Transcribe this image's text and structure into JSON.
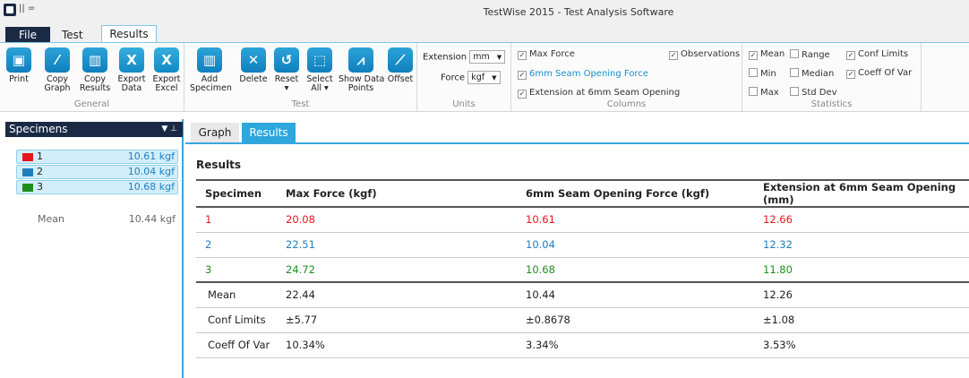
{
  "window": {
    "title": "TestWise 2015 - Test Analysis Software",
    "qat_glyph": "||  ="
  },
  "menu_tabs": {
    "file": "File",
    "test": "Test",
    "results": "Results"
  },
  "ribbon": {
    "general": {
      "label": "General",
      "buttons": [
        {
          "label": "Print",
          "icon": "printer-icon"
        },
        {
          "label": "Copy\nGraph",
          "icon": "copy-graph-icon"
        },
        {
          "label": "Copy\nResults",
          "icon": "copy-results-icon"
        },
        {
          "label": "Export\nData",
          "icon": "excel-icon"
        },
        {
          "label": "Export\nExcel",
          "icon": "excel-icon"
        }
      ]
    },
    "test": {
      "label": "Test",
      "buttons": [
        {
          "label": "Add\nSpecimen",
          "icon": "add-specimen-icon"
        },
        {
          "label": "Delete",
          "icon": "delete-icon"
        },
        {
          "label": "Reset\n▾",
          "icon": "reset-icon"
        },
        {
          "label": "Select\nAll ▾",
          "icon": "select-all-icon"
        },
        {
          "label": "Show Data\nPoints",
          "icon": "data-points-icon"
        },
        {
          "label": "Offset",
          "icon": "offset-icon"
        }
      ]
    },
    "units": {
      "label": "Units",
      "extension_label": "Extension",
      "extension_value": "mm",
      "force_label": "Force",
      "force_value": "kgf"
    },
    "columns": {
      "label": "Columns",
      "max_force": "Max Force",
      "seam_force": "6mm Seam Opening Force",
      "extension": "Extension at 6mm Seam Opening",
      "observations": "Observations"
    },
    "statistics": {
      "label": "Statistics",
      "mean": "Mean",
      "range": "Range",
      "conf_limits": "Conf Limits",
      "min": "Min",
      "median": "Median",
      "coeff_of_var": "Coeff Of Var",
      "max": "Max",
      "std_dev": "Std Dev"
    }
  },
  "specimens_panel": {
    "title": "Specimens",
    "items": [
      {
        "label": "1",
        "value": "10.61 kgf",
        "color": "#e8141c"
      },
      {
        "label": "2",
        "value": "10.04 kgf",
        "color": "#1e7fc0"
      },
      {
        "label": "3",
        "value": "10.68 kgf",
        "color": "#1e8e1e"
      }
    ],
    "mean_label": "Mean",
    "mean_value": "10.44 kgf"
  },
  "view_tabs": {
    "graph": "Graph",
    "results": "Results"
  },
  "results": {
    "heading": "Results",
    "columns": [
      "Specimen",
      "Max Force (kgf)",
      "6mm Seam Opening Force (kgf)",
      "Extension at 6mm Seam Opening (mm)"
    ],
    "rows": [
      {
        "specimen": "1",
        "max_force": "20.08",
        "seam_force": "10.61",
        "extension": "12.66",
        "color": "#e8141c"
      },
      {
        "specimen": "2",
        "max_force": "22.51",
        "seam_force": "10.04",
        "extension": "12.32",
        "color": "#1e7fc0"
      },
      {
        "specimen": "3",
        "max_force": "24.72",
        "seam_force": "10.68",
        "extension": "11.80",
        "color": "#1e8e1e"
      }
    ],
    "stats": [
      {
        "label": "Mean",
        "max_force": "22.44",
        "seam_force": "10.44",
        "extension": "12.26"
      },
      {
        "label": "Conf Limits",
        "max_force": "±5.77",
        "seam_force": "±0.8678",
        "extension": "±1.08"
      },
      {
        "label": "Coeff Of Var",
        "max_force": "10.34%",
        "seam_force": "3.34%",
        "extension": "3.53%"
      }
    ]
  }
}
